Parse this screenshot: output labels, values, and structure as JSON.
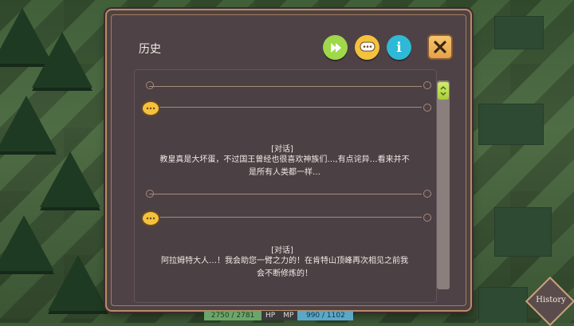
{
  "history_panel": {
    "title": "历史",
    "header_icons": [
      "skip-icon",
      "dialogue-filter-icon",
      "info-icon",
      "close-icon"
    ],
    "entries": [
      {
        "tag": "[对话]",
        "lines": [
          "教皇真是大坏蛋，不过国王曾经也很喜欢神族们…,有点诧异…看来并不",
          "是所有人类都一样…"
        ]
      },
      {
        "tag": "[对话]",
        "lines": [
          "阿拉姆特大人…！我会助您一臂之力的！在肯特山顶峰再次相见之前我",
          "会不断修炼的！"
        ]
      }
    ]
  },
  "status_bar": {
    "hp_value": "2750 / 2781",
    "hp_label": "HP",
    "mp_label": "MP",
    "mp_value": "990 / 1102"
  },
  "history_button": {
    "label": "History"
  },
  "colors": {
    "panel": "#4e4246",
    "gold": "#b98d63",
    "bubble": "#f4c23c",
    "scroll_thumb": "#c2e055"
  }
}
